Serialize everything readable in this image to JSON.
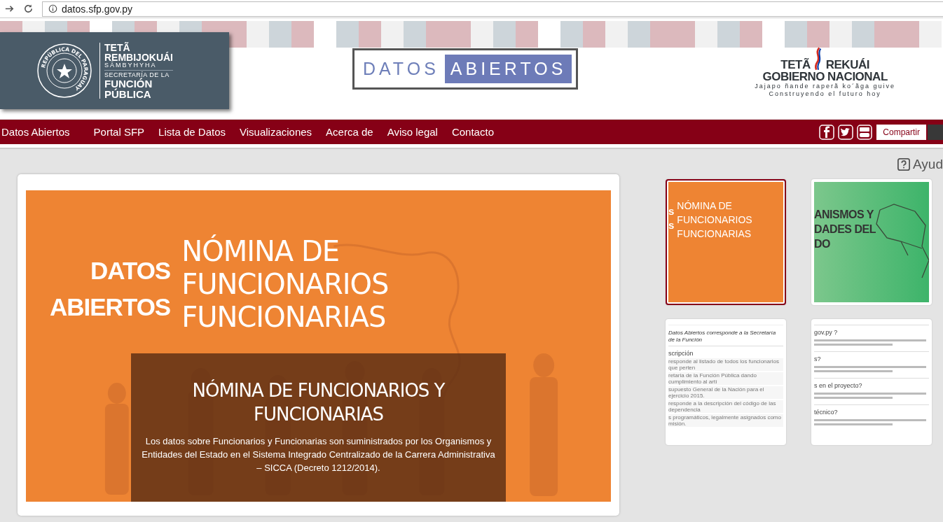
{
  "browser": {
    "url": "datos.sfp.gov.py"
  },
  "header": {
    "left_logo": {
      "seal_text": "REPÚBLICA DEL PARAGUAY",
      "lines": [
        "TETÃ",
        "REMBIJOKUÁI",
        "SÃMBYHYHA",
        "SECRETARÍA DE LA",
        "FUNCIÓN",
        "PÚBLICA"
      ]
    },
    "center_logo": [
      "DATOS",
      "ABIERTOS"
    ],
    "right_logo": {
      "top": [
        "TETÃ",
        "REKUÁI"
      ],
      "bottom": [
        "GOBIERNO",
        "NACIONAL"
      ],
      "tagline_gn": "Jajapo ñande raperã ko´ãga guive",
      "tagline_es": "Construyendo el futuro hoy"
    }
  },
  "nav": {
    "items": [
      "Datos Abiertos",
      "Portal SFP",
      "Lista de Datos",
      "Visualizaciones",
      "Acerca de",
      "Aviso legal",
      "Contacto"
    ],
    "share_button": "Compartir"
  },
  "help": "Ayud",
  "banner": {
    "brand": [
      "DATOS",
      "ABIERTOS"
    ],
    "title_lines": [
      "NÓMINA DE",
      "FUNCIONARIOS",
      "FUNCIONARIAS"
    ],
    "caption_title": "NÓMINA DE FUNCIONARIOS Y FUNCIONARIAS",
    "caption_text": "Los datos sobre Funcionarios y Funcionarias son suministrados por los Organismos y Entidades del Estado en el Sistema Integrado Centralizado de la Carrera Administrativa – SICCA (Decreto 1212/2014)."
  },
  "thumbnails": [
    {
      "kind": "orange",
      "selected": true,
      "brand": [
        "s",
        "s"
      ],
      "lines": [
        "NÓMINA DE",
        "FUNCIONARIOS",
        "FUNCIONARIAS"
      ]
    },
    {
      "kind": "green",
      "selected": false,
      "lines": [
        "ANISMOS Y",
        "DADES DEL",
        "DO"
      ]
    },
    {
      "kind": "doc",
      "selected": false,
      "items": [
        {
          "kind": "italic",
          "text": "Datos Abiertos corresponde a la Secretaría de la Función"
        },
        {
          "kind": "heading",
          "text": "scripción"
        },
        {
          "kind": "text",
          "text": "responde al listado de todos los funcionarios que perten"
        },
        {
          "kind": "text",
          "text": "retaria de la Función Pública dando cumplimiento al artí"
        },
        {
          "kind": "text",
          "text": "supuesto General de la Nación para el ejercicio 2015."
        },
        {
          "kind": "text",
          "text": "responde a la descripción del código de las dependencia"
        },
        {
          "kind": "text",
          "text": "s programáticos, legalmente asignados como misión."
        }
      ]
    },
    {
      "kind": "doc",
      "selected": false,
      "items": [
        {
          "kind": "heading",
          "text": "gov.py ?"
        },
        {
          "kind": "blur"
        },
        {
          "kind": "heading",
          "text": "s?"
        },
        {
          "kind": "blur"
        },
        {
          "kind": "heading",
          "text": "s en el proyecto?"
        },
        {
          "kind": "blur"
        },
        {
          "kind": "heading",
          "text": "técnico?"
        },
        {
          "kind": "blur"
        }
      ]
    }
  ]
}
